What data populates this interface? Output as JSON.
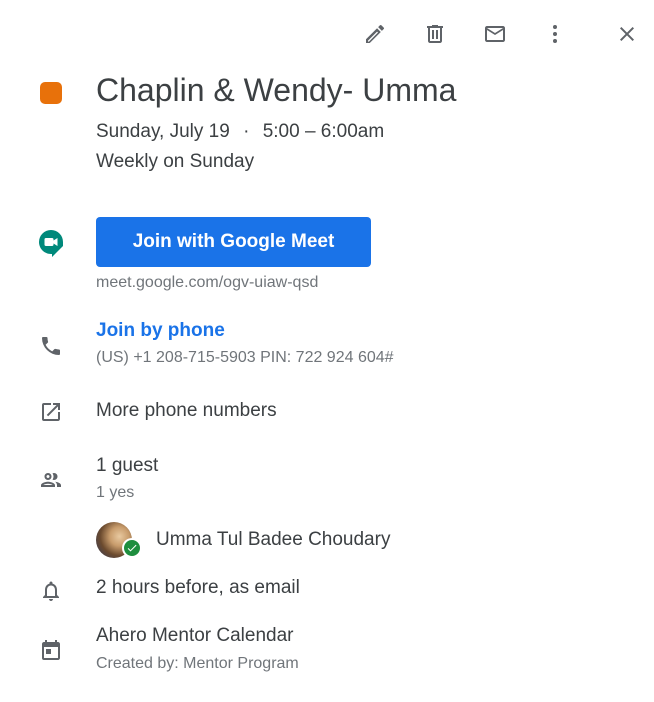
{
  "toolbar": {
    "edit_icon": "pencil-icon",
    "delete_icon": "trash-icon",
    "email_icon": "mail-icon",
    "more_icon": "more-vert-icon",
    "close_icon": "close-icon"
  },
  "event": {
    "color": "#e8710a",
    "title": "Chaplin & Wendy- Umma",
    "date": "Sunday, July 19",
    "separator": "·",
    "time": "5:00 – 6:00am",
    "recurrence": "Weekly on Sunday"
  },
  "conference": {
    "button_label": "Join with Google Meet",
    "meet_link": "meet.google.com/ogv-uiaw-qsd",
    "phone_label": "Join by phone",
    "phone_detail": "(US) +1 208-715-5903 PIN: 722 924 604#",
    "more_numbers": "More phone numbers"
  },
  "guests": {
    "count": "1 guest",
    "responses": "1 yes",
    "list": [
      {
        "name": "Umma Tul Badee Choudary"
      }
    ]
  },
  "reminder": "2 hours before, as email",
  "calendar": {
    "name": "Ahero Mentor Calendar",
    "created_by": "Created by: Mentor Program"
  },
  "colors": {
    "accent": "#1a73e8",
    "meet_green": "#00897b",
    "check_green": "#1e8e3e"
  }
}
